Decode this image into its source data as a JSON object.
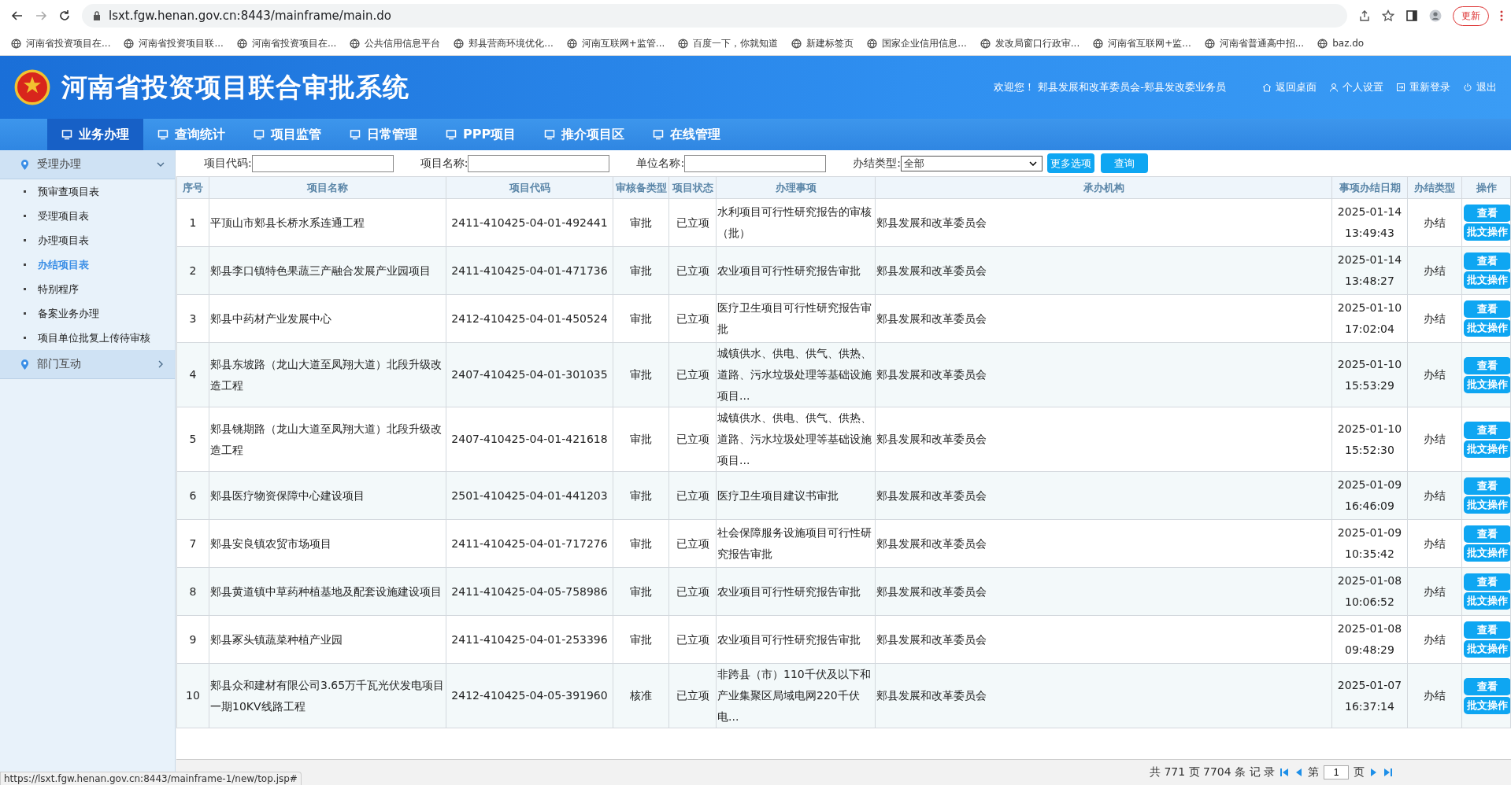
{
  "browser": {
    "url": "lsxt.fgw.henan.gov.cn:8443/mainframe/main.do",
    "update_button": "更新",
    "bookmarks": [
      "河南省投资项目在...",
      "河南省投资项目联...",
      "河南省投资项目在...",
      "公共信用信息平台",
      "郏县营商环境优化...",
      "河南互联网+监管...",
      "百度一下，你就知道",
      "新建标签页",
      "国家企业信用信息...",
      "发改局窗口行政审...",
      "河南省互联网+监...",
      "河南省普通高中招...",
      "baz.do"
    ]
  },
  "header": {
    "title": "河南省投资项目联合审批系统",
    "welcome": "欢迎您！ 郏县发展和改革委员会-郏县发改委业务员",
    "links": [
      "返回桌面",
      "个人设置",
      "重新登录",
      "退出"
    ]
  },
  "nav": [
    {
      "label": "业务办理",
      "selected": true
    },
    {
      "label": "查询统计",
      "selected": false
    },
    {
      "label": "项目监管",
      "selected": false
    },
    {
      "label": "日常管理",
      "selected": false
    },
    {
      "label": "PPP项目",
      "selected": false
    },
    {
      "label": "推介项目区",
      "selected": false
    },
    {
      "label": "在线管理",
      "selected": false
    }
  ],
  "sidebar": [
    {
      "label": "受理办理",
      "expanded": true,
      "items": [
        {
          "label": "预审查项目表",
          "selected": false
        },
        {
          "label": "受理项目表",
          "selected": false
        },
        {
          "label": "办理项目表",
          "selected": false
        },
        {
          "label": "办结项目表",
          "selected": true
        },
        {
          "label": "特别程序",
          "selected": false
        },
        {
          "label": "备案业务办理",
          "selected": false
        },
        {
          "label": "项目单位批复上传待审核",
          "selected": false
        }
      ]
    },
    {
      "label": "部门互动",
      "expanded": false
    }
  ],
  "filters": {
    "fields": [
      "项目代码:",
      "项目名称:",
      "单位名称:"
    ],
    "type_label": "办结类型:",
    "type_value": "全部",
    "buttons": [
      "更多选项",
      "查询"
    ]
  },
  "table": {
    "columns": [
      "序号",
      "项目名称",
      "项目代码",
      "审核备类型",
      "项目状态",
      "办理事项",
      "承办机构",
      "事项办结日期",
      "办结类型",
      "操作"
    ],
    "rows": [
      {
        "cells": [
          "1",
          "平顶山市郏县长桥水系连通工程",
          "2411-410425-04-01-492441",
          "审批",
          "已立项",
          "水利项目可行性研究报告的审核（批）",
          "郏县发展和改革委员会",
          "2025-01-14 13:49:43",
          "办结"
        ],
        "actions": [
          "查看",
          "批文操作"
        ]
      },
      {
        "cells": [
          "2",
          "郏县李口镇特色果蔬三产融合发展产业园项目",
          "2411-410425-04-01-471736",
          "审批",
          "已立项",
          "农业项目可行性研究报告审批",
          "郏县发展和改革委员会",
          "2025-01-14 13:48:27",
          "办结"
        ],
        "actions": [
          "查看",
          "批文操作"
        ]
      },
      {
        "cells": [
          "3",
          "郏县中药材产业发展中心",
          "2412-410425-04-01-450524",
          "审批",
          "已立项",
          "医疗卫生项目可行性研究报告审批",
          "郏县发展和改革委员会",
          "2025-01-10 17:02:04",
          "办结"
        ],
        "actions": [
          "查看",
          "批文操作"
        ]
      },
      {
        "cells": [
          "4",
          "郏县东坡路（龙山大道至凤翔大道）北段升级改造工程",
          "2407-410425-04-01-301035",
          "审批",
          "已立项",
          "城镇供水、供电、供气、供热、道路、污水垃圾处理等基础设施项目...",
          "郏县发展和改革委员会",
          "2025-01-10 15:53:29",
          "办结"
        ],
        "actions": [
          "查看",
          "批文操作"
        ]
      },
      {
        "cells": [
          "5",
          "郏县铫期路（龙山大道至凤翔大道）北段升级改造工程",
          "2407-410425-04-01-421618",
          "审批",
          "已立项",
          "城镇供水、供电、供气、供热、道路、污水垃圾处理等基础设施项目...",
          "郏县发展和改革委员会",
          "2025-01-10 15:52:30",
          "办结"
        ],
        "actions": [
          "查看",
          "批文操作"
        ]
      },
      {
        "cells": [
          "6",
          "郏县医疗物资保障中心建设项目",
          "2501-410425-04-01-441203",
          "审批",
          "已立项",
          "医疗卫生项目建议书审批",
          "郏县发展和改革委员会",
          "2025-01-09 16:46:09",
          "办结"
        ],
        "actions": [
          "查看",
          "批文操作"
        ]
      },
      {
        "cells": [
          "7",
          "郏县安良镇农贸市场项目",
          "2411-410425-04-01-717276",
          "审批",
          "已立项",
          "社会保障服务设施项目可行性研究报告审批",
          "郏县发展和改革委员会",
          "2025-01-09 10:35:42",
          "办结"
        ],
        "actions": [
          "查看",
          "批文操作"
        ]
      },
      {
        "cells": [
          "8",
          "郏县黄道镇中草药种植基地及配套设施建设项目",
          "2411-410425-04-05-758986",
          "审批",
          "已立项",
          "农业项目可行性研究报告审批",
          "郏县发展和改革委员会",
          "2025-01-08 10:06:52",
          "办结"
        ],
        "actions": [
          "查看",
          "批文操作"
        ]
      },
      {
        "cells": [
          "9",
          "郏县冢头镇蔬菜种植产业园",
          "2411-410425-04-01-253396",
          "审批",
          "已立项",
          "农业项目可行性研究报告审批",
          "郏县发展和改革委员会",
          "2025-01-08 09:48:29",
          "办结"
        ],
        "actions": [
          "查看",
          "批文操作"
        ]
      },
      {
        "cells": [
          "10",
          "郏县众和建材有限公司3.65万千瓦光伏发电项目一期10KV线路工程",
          "2412-410425-04-05-391960",
          "核准",
          "已立项",
          "非跨县（市）110千伏及以下和产业集聚区局域电网220千伏电...",
          "郏县发展和改革委员会",
          "2025-01-07 16:37:14",
          "办结"
        ],
        "actions": [
          "查看",
          "批文操作"
        ]
      }
    ]
  },
  "pager": {
    "summary": "共 771 页 7704 条 记 录",
    "page_prefix": "第",
    "page": "1",
    "page_suffix": "页"
  },
  "status_url": "https://lsxt.fgw.henan.gov.cn:8443/mainframe-1/new/top.jsp#"
}
